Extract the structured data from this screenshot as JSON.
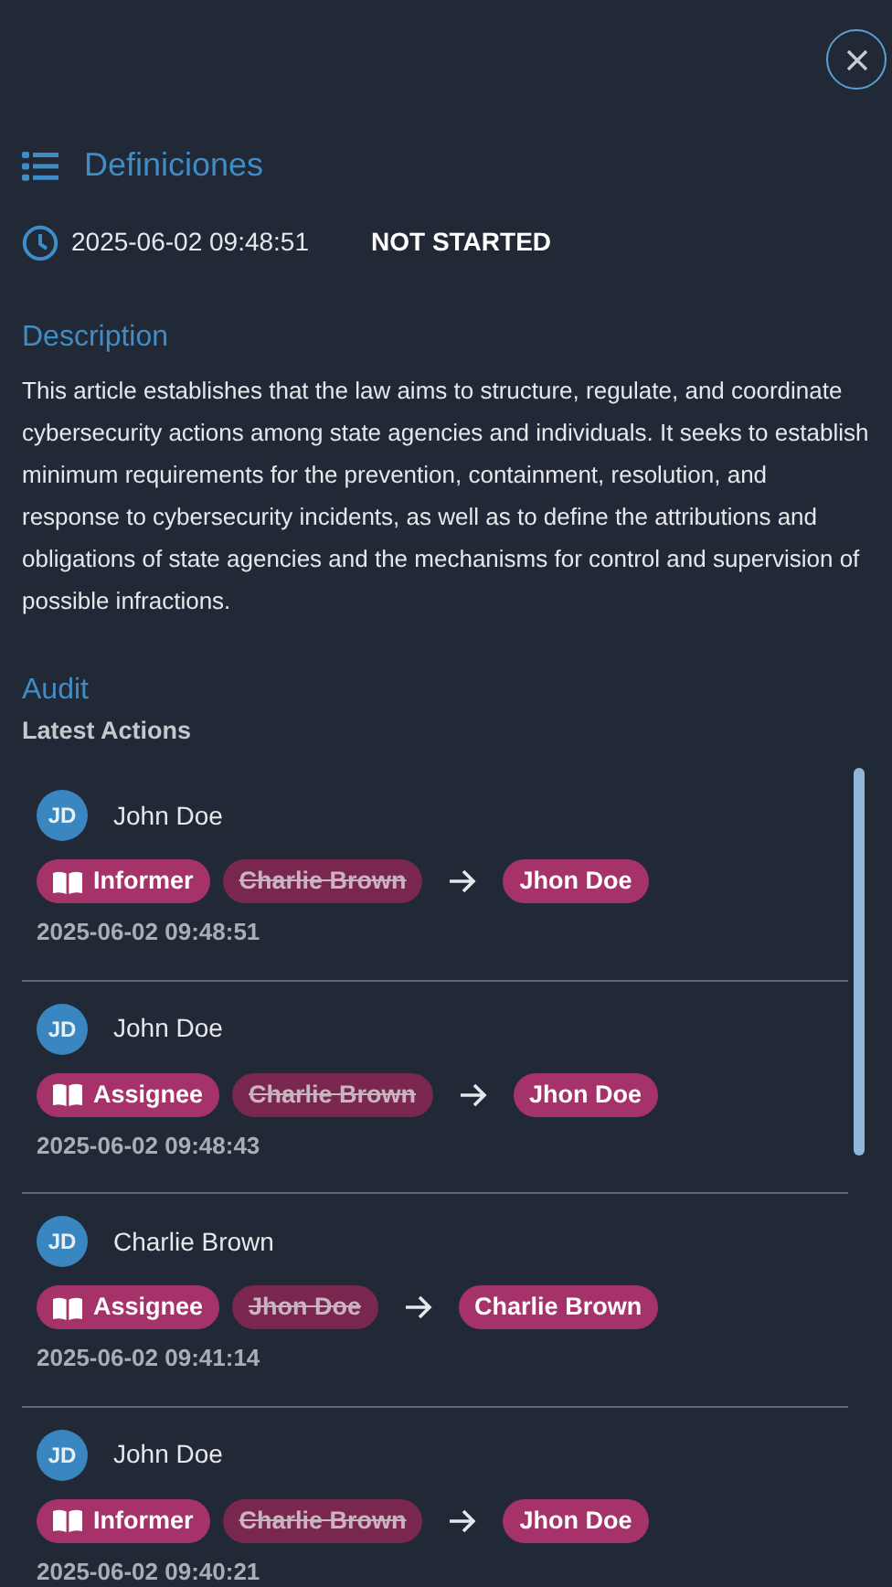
{
  "header": {
    "title": "Definiciones",
    "timestamp": "2025-06-02 09:48:51",
    "status": "NOT STARTED"
  },
  "description": {
    "label": "Description",
    "text": "This article establishes that the law aims to structure, regulate, and coordinate cybersecurity actions among state agencies and individuals. It seeks to establish minimum requirements for the prevention, containment, resolution, and response to cybersecurity incidents, as well as to define the attributions and obligations of state agencies and the mechanisms for control and supervision of possible infractions."
  },
  "audit": {
    "label": "Audit",
    "sublabel": "Latest Actions",
    "actions": [
      {
        "initials": "JD",
        "user": "John Doe",
        "role": "Informer",
        "from": "Charlie Brown",
        "to": "Jhon Doe",
        "time": "2025-06-02 09:48:51"
      },
      {
        "initials": "JD",
        "user": "John Doe",
        "role": "Assignee",
        "from": "Charlie Brown",
        "to": "Jhon Doe",
        "time": "2025-06-02 09:48:43"
      },
      {
        "initials": "JD",
        "user": "Charlie Brown",
        "role": "Assignee",
        "from": "Jhon Doe",
        "to": "Charlie Brown",
        "time": "2025-06-02 09:41:14"
      },
      {
        "initials": "JD",
        "user": "John Doe",
        "role": "Informer",
        "from": "Charlie Brown",
        "to": "Jhon Doe",
        "time": "2025-06-02 09:40:21"
      }
    ]
  }
}
